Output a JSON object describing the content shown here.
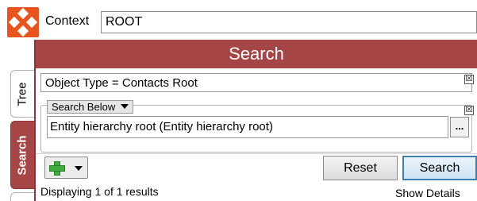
{
  "context": {
    "label": "Context",
    "value": "ROOT"
  },
  "tabs": [
    {
      "label": "Tree"
    },
    {
      "label": "Search"
    }
  ],
  "search_panel": {
    "title": "Search",
    "object_type_filter": "Object Type = Contacts Root",
    "scope_selector": "Search Below",
    "entity_value": "Entity hierarchy root (Entity hierarchy root)",
    "browse_label": "...",
    "close_glyph": "☒"
  },
  "buttons": {
    "reset": "Reset",
    "search": "Search"
  },
  "status_text": "Displaying 1 of 1 results",
  "show_details": "Show Details",
  "colors": {
    "accent": "#a64546",
    "logo": "#e8541e",
    "add_icon": "#3fae3f",
    "search_focus": "#3c7fb1"
  },
  "icons": {
    "app_logo": "app-logo-icon",
    "add": "green-plus-icon",
    "dropdown": "chevron-down-icon",
    "close": "close-icon"
  }
}
